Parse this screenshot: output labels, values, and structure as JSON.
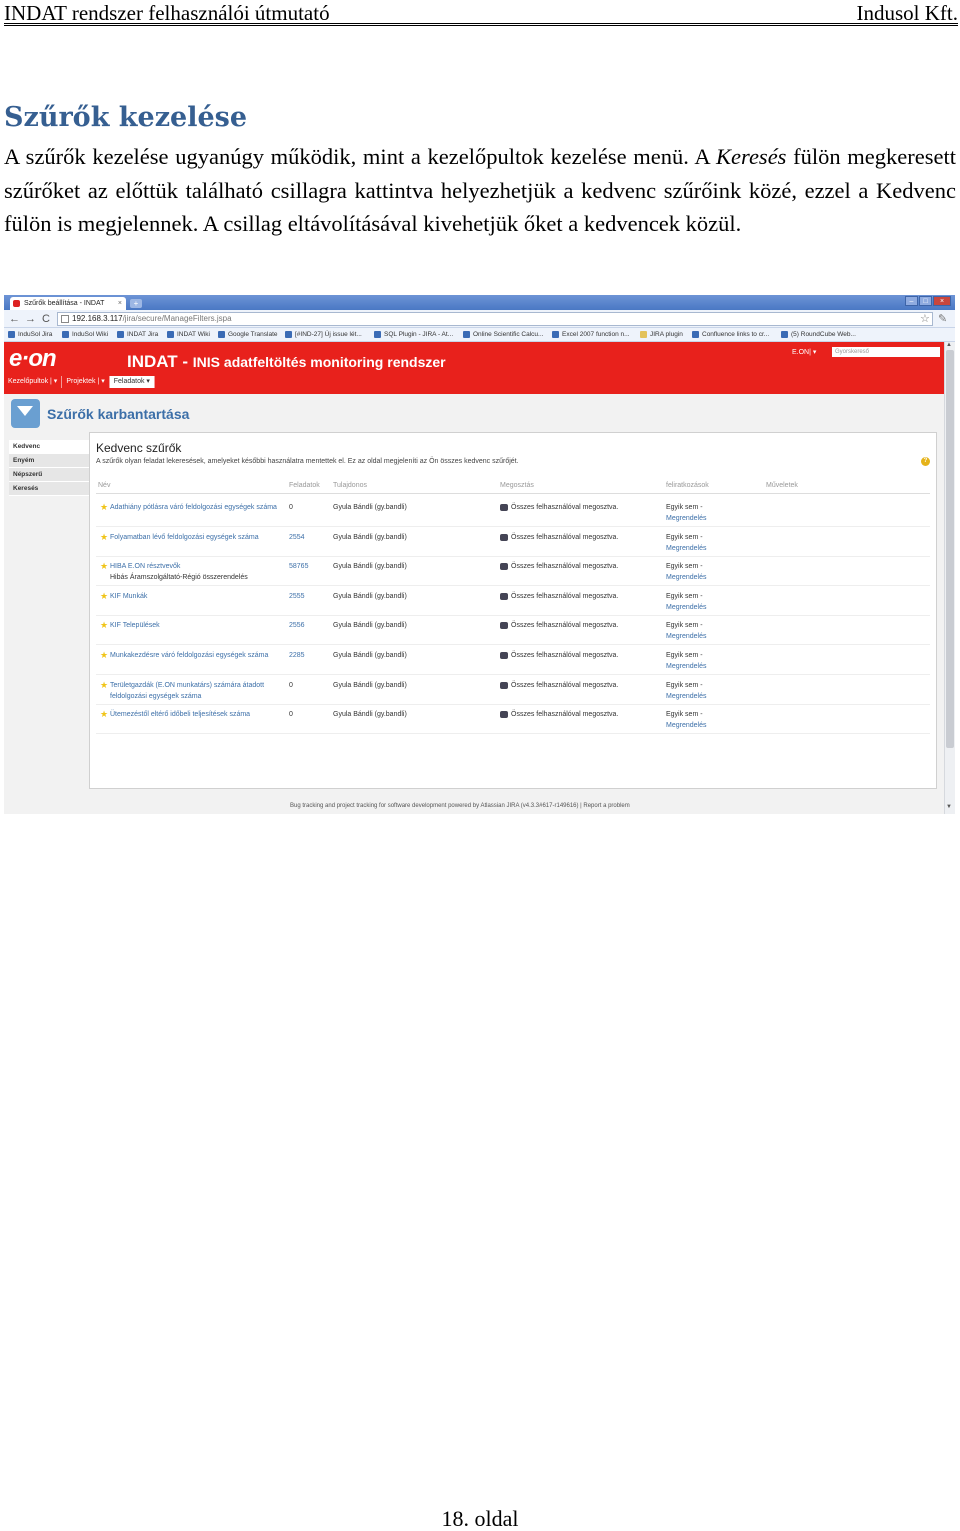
{
  "doc": {
    "header_left": "INDAT rendszer felhasználói útmutató",
    "header_right": "Indusol Kft.",
    "section_title": "Szűrők kezelése",
    "para_1": "A szűrők kezelése ugyanúgy működik, mint a kezelőpultok kezelése menü. A ",
    "para_italic": "Keresés",
    "para_2": " fülön megkeresett szűrőket az előttük található csillagra kattintva helyezhetjük a kedvenc szűrőink közé, ezzel a Kedvenc fülön is megjelennek. A csillag eltávolításával kivehetjük őket a kedvencek közül.",
    "footer": "18. oldal"
  },
  "browser": {
    "tab_title": "Szűrők beállítása - INDAT",
    "tab_close": "×",
    "new_tab": "+",
    "win_min": "–",
    "win_max": "□",
    "win_close": "×",
    "back": "←",
    "forward": "→",
    "reload": "C",
    "url_host": "192.168.3.117",
    "url_path": "/jira/secure/ManageFilters.jspa",
    "star": "☆",
    "wrench": "✎",
    "bookmarks": [
      "InduSol Jira",
      "InduSol Wiki",
      "INDAT Jira",
      "INDAT Wiki",
      "Google Translate",
      "[#IND-27] Új issue lét...",
      "SQL Plugin - JIRA - At...",
      "Online Scientific Calcu...",
      "Excel 2007 function n...",
      "JIRA plugin",
      "Confluence links to cr...",
      "(5) RoundCube Web..."
    ]
  },
  "app": {
    "logo": "e·on",
    "brand_main": "INDAT",
    "brand_sep": " - ",
    "brand_sub": "INIS adatfeltöltés monitoring rendszer",
    "user": "E.ON| ▾",
    "quick_search": "Gyorskereső",
    "menu": [
      "Kezelőpultok | ▾",
      "Projektek | ▾",
      "Feladatok ▾"
    ],
    "page_title": "Szűrők karbantartása",
    "side_tabs": [
      "Kedvenc",
      "Enyém",
      "Népszerű",
      "Keresés"
    ],
    "panel_title": "Kedvenc szűrők",
    "panel_desc": "A szűrők olyan feladat lekeresések, amelyeket későbbi használatra mentettek el. Ez az oldal megjeleníti az Ön összes kedvenc szűrőjét.",
    "help": "?",
    "columns": {
      "name": "Név",
      "issues": "Feladatok",
      "owner": "Tulajdonos",
      "shared": "Megosztás",
      "subs": "feliratkozások",
      "ops": "Műveletek"
    },
    "fav_star": "★",
    "rows": [
      {
        "name": "Adathiány pótlásra váró feldolgozási egységek száma",
        "desc": "",
        "count": "0",
        "count_link": false,
        "owner": "Gyula Bándli (gy.bandli)",
        "shared": "Összes felhasználóval megosztva.",
        "sub": "Egyik sem -",
        "sub_link": "Megrendelés"
      },
      {
        "name": "Folyamatban lévő feldolgozási egységek száma",
        "desc": "",
        "count": "2554",
        "count_link": true,
        "owner": "Gyula Bándli (gy.bandli)",
        "shared": "Összes felhasználóval megosztva.",
        "sub": "Egyik sem -",
        "sub_link": "Megrendelés"
      },
      {
        "name": "HIBA E.ON résztvevők",
        "desc": "Hibás Áramszolgáltató-Régió összerendelés",
        "count": "58765",
        "count_link": true,
        "owner": "Gyula Bándli (gy.bandli)",
        "shared": "Összes felhasználóval megosztva.",
        "sub": "Egyik sem -",
        "sub_link": "Megrendelés"
      },
      {
        "name": "KIF Munkák",
        "desc": "",
        "count": "2555",
        "count_link": true,
        "owner": "Gyula Bándli (gy.bandli)",
        "shared": "Összes felhasználóval megosztva.",
        "sub": "Egyik sem -",
        "sub_link": "Megrendelés"
      },
      {
        "name": "KIF Települések",
        "desc": "",
        "count": "2556",
        "count_link": true,
        "owner": "Gyula Bándli (gy.bandli)",
        "shared": "Összes felhasználóval megosztva.",
        "sub": "Egyik sem -",
        "sub_link": "Megrendelés"
      },
      {
        "name": "Munkakezdésre váró feldolgozási egységek száma",
        "desc": "",
        "count": "2285",
        "count_link": true,
        "owner": "Gyula Bándli (gy.bandli)",
        "shared": "Összes felhasználóval megosztva.",
        "sub": "Egyik sem -",
        "sub_link": "Megrendelés"
      },
      {
        "name": "Területgazdák (E.ON munkatárs) számára átadott feldolgozási egységek száma",
        "desc": "",
        "count": "0",
        "count_link": false,
        "owner": "Gyula Bándli (gy.bandli)",
        "shared": "Összes felhasználóval megosztva.",
        "sub": "Egyik sem -",
        "sub_link": "Megrendelés"
      },
      {
        "name": "Ütemezéstől eltérő időbeli teljesítések száma",
        "desc": "",
        "count": "0",
        "count_link": false,
        "owner": "Gyula Bándli (gy.bandli)",
        "shared": "Összes felhasználóval megosztva.",
        "sub": "Egyik sem -",
        "sub_link": "Megrendelés"
      }
    ],
    "powered_by": "Bug tracking and project tracking for software development powered by Atlassian JIRA (v4.3.3#617-r149616) | Report a problem",
    "scroll_up": "▲",
    "scroll_down": "▼"
  }
}
